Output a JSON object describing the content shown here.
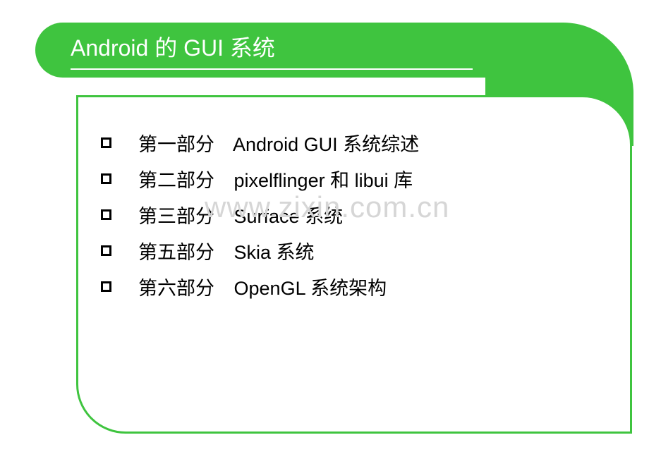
{
  "title": "Android 的 GUI 系统",
  "items": [
    {
      "part": "第一部分",
      "desc": "Android GUI 系统综述"
    },
    {
      "part": "第二部分",
      "desc": "pixelflinger 和 libui 库"
    },
    {
      "part": "第三部分",
      "desc": "Surface 系统"
    },
    {
      "part": "第五部分",
      "desc": "Skia 系统"
    },
    {
      "part": "第六部分",
      "desc": "OpenGL 系统架构"
    }
  ],
  "watermark": "www.zixin.com.cn"
}
